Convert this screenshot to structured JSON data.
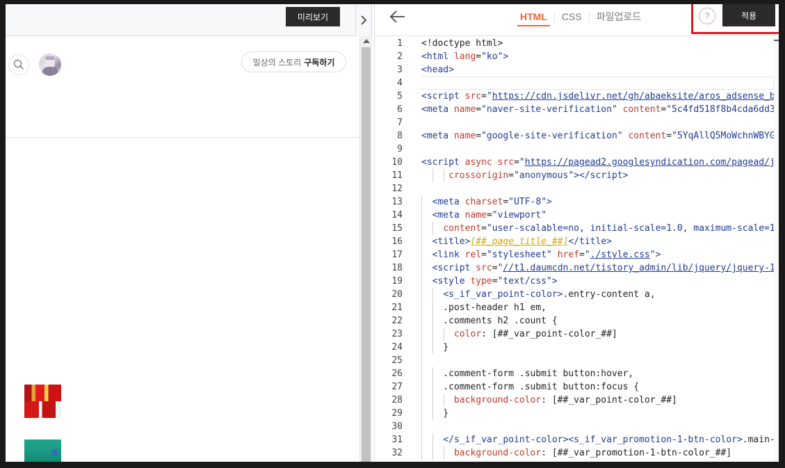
{
  "left": {
    "preview_label": "미리보기",
    "collapse_icon": "chevron-right-icon",
    "subscribe_prefix": "일상의 스토리",
    "subscribe_action": "구독하기"
  },
  "editor": {
    "back_icon": "arrow-left-icon",
    "tabs": [
      {
        "label": "HTML",
        "active": true
      },
      {
        "label": "CSS",
        "active": false
      },
      {
        "label": "파일업로드",
        "active": false
      }
    ],
    "help_label": "?",
    "apply_label": "적용",
    "highlight_color": "#e0191f",
    "accent_color": "#f06332",
    "line_numbers": [
      "1",
      "2",
      "3",
      "4",
      "5",
      "6",
      "7",
      "8",
      "9",
      "10",
      "11",
      "12",
      "13",
      "14",
      "15",
      "16",
      "17",
      "18",
      "19",
      "20",
      "21",
      "22",
      "23",
      "24",
      "25",
      "26",
      "27",
      "28",
      "29",
      "30",
      "31",
      "32"
    ]
  }
}
